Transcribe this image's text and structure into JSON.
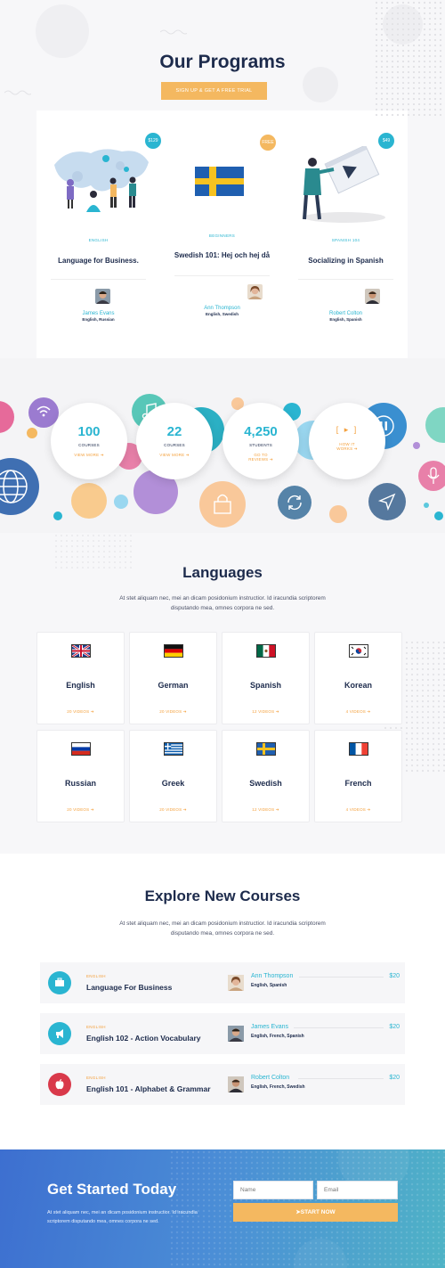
{
  "programs": {
    "title": "Our Programs",
    "cta_label": "SIGN UP & GET A FREE TRIAL",
    "cards": [
      {
        "price": "$129",
        "category": "ENGLISH",
        "title": "Language for Business.",
        "teacher": "James Evans",
        "langs": "English, Russian",
        "price_color": "#2ab5d1"
      },
      {
        "price": "FREE",
        "category": "BEGINNERS",
        "title": "Swedish 101: Hej och hej då",
        "teacher": "Ann Thompson",
        "langs": "English, Swedish",
        "price_color": "#f4b860"
      },
      {
        "price": "$49",
        "category": "SPANISH 104",
        "title": "Socializing in Spanish",
        "teacher": "Robert Colton",
        "langs": "English, Spanish",
        "price_color": "#2ab5d1"
      }
    ]
  },
  "stats": [
    {
      "number": "100",
      "label": "COURSES",
      "link": "VIEW MORE"
    },
    {
      "number": "22",
      "label": "COURSES",
      "link": "VIEW MORE"
    },
    {
      "number": "4,250",
      "label": "STUDENTS",
      "link": "GO TO REVIEWS"
    },
    {
      "icon": "play-icon",
      "link": "HOW IT WORKS"
    }
  ],
  "languages": {
    "title": "Languages",
    "text": "At stet aliquam nec, mei an dicam posidonium instructior. Id iracundia scriptorem disputando mea, omnes corpora ne sed.",
    "items": [
      {
        "name": "English",
        "videos": "20 VIDEOS",
        "flag": "uk-flag-icon"
      },
      {
        "name": "German",
        "videos": "20 VIDEOS",
        "flag": "germany-flag-icon"
      },
      {
        "name": "Spanish",
        "videos": "12 VIDEOS",
        "flag": "mexico-flag-icon"
      },
      {
        "name": "Korean",
        "videos": "4 VIDEOS",
        "flag": "korea-flag-icon"
      },
      {
        "name": "Russian",
        "videos": "20 VIDEOS",
        "flag": "russia-flag-icon"
      },
      {
        "name": "Greek",
        "videos": "20 VIDEOS",
        "flag": "greece-flag-icon"
      },
      {
        "name": "Swedish",
        "videos": "12 VIDEOS",
        "flag": "sweden-flag-icon"
      },
      {
        "name": "French",
        "videos": "4 VIDEOS",
        "flag": "france-flag-icon"
      }
    ]
  },
  "explore": {
    "title": "Explore New Courses",
    "text": "At stet aliquam nec, mei an dicam posidonium instructior. Id iracundia scriptorem disputando mea, omnes corpora ne sed.",
    "courses": [
      {
        "category": "ENGLISH",
        "title": "Language For Business",
        "teacher": "Ann Thompson",
        "langs": "English, Spanish",
        "price": "$20",
        "icon": "briefcase-icon",
        "icon_color": "#2ab5d1"
      },
      {
        "category": "ENGLISH",
        "title": "English 102 - Action Vocabulary",
        "teacher": "James Evans",
        "langs": "English, French, Spanish",
        "price": "$20",
        "icon": "megaphone-icon",
        "icon_color": "#2ab5d1"
      },
      {
        "category": "ENGLISH",
        "title": "English 101 - Alphabet & Grammar",
        "teacher": "Robert Colton",
        "langs": "English, French, Swedish",
        "price": "$20",
        "icon": "apple-icon",
        "icon_color": "#d9394a"
      }
    ]
  },
  "cta": {
    "title": "Get Started Today",
    "text": "At stet aliquam nec, mei an dicam posidonium instructior. Id iracundia scriptorem disputando mea, omnes corpora ne sed.",
    "name_placeholder": "Name",
    "email_placeholder": "Email",
    "button": "START NOW"
  },
  "colors": {
    "accent": "#2ab5d1",
    "orange": "#f4b860",
    "navy": "#1d2b4c"
  }
}
